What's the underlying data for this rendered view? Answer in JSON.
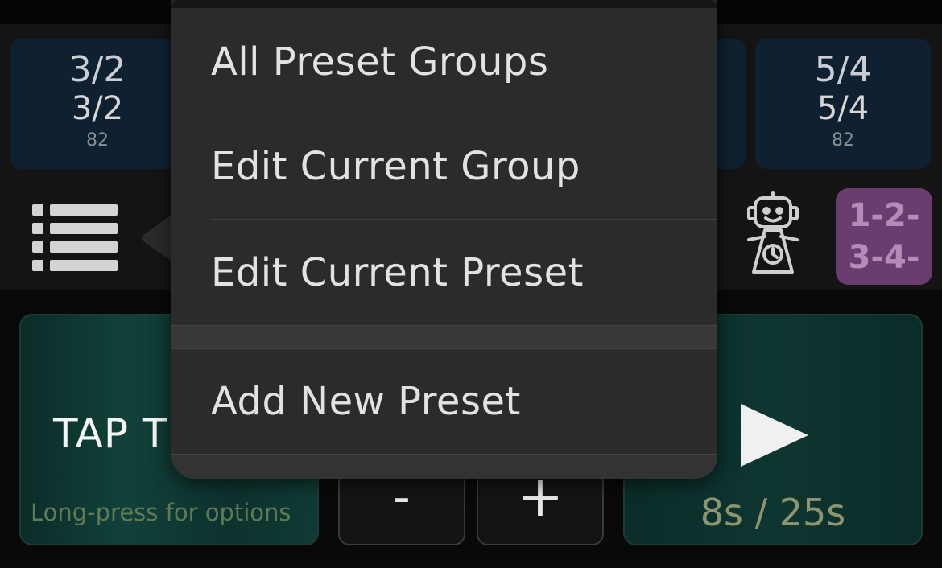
{
  "presets": {
    "left": {
      "ts_top": "3/2",
      "ts_bottom": "3/2",
      "bpm": "82"
    },
    "right": {
      "ts_top": "5/4",
      "ts_bottom": "5/4",
      "bpm": "82"
    }
  },
  "count_badge": {
    "line1": "1-2-",
    "line2": "3-4-"
  },
  "tap": {
    "label": "TAP TE",
    "hint": "Long-press for options"
  },
  "stepper": {
    "minus": "-",
    "plus": "+"
  },
  "player": {
    "timer": "8s / 25s"
  },
  "menu": {
    "items": [
      {
        "label": "All Preset Groups"
      },
      {
        "label": "Edit Current Group"
      },
      {
        "label": "Edit Current Preset"
      },
      {
        "label": "Add New Preset"
      }
    ]
  },
  "icons": {
    "list": "list-icon",
    "robot": "metronome-robot-icon",
    "play": "play-icon",
    "menu_arrow": "popover-arrow"
  },
  "colors": {
    "preset_card": "#0f2130",
    "badge": "#6b3c70",
    "tap_bg": "#12413a",
    "menu_bg": "#2b2b2b"
  }
}
